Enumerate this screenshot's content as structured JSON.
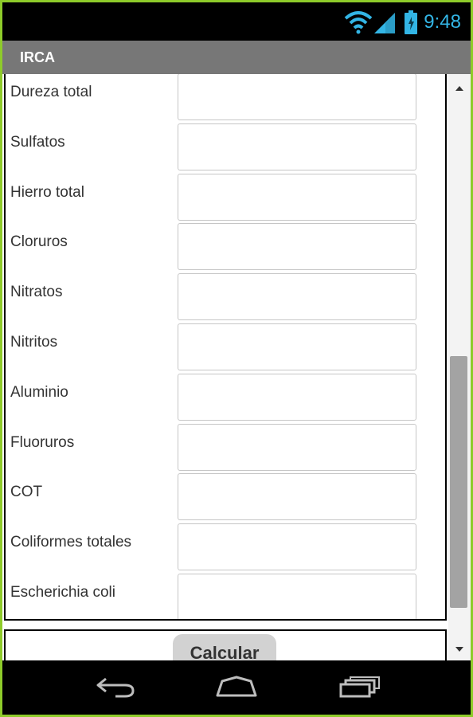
{
  "status_bar": {
    "time": "9:48",
    "icons": [
      "wifi-icon",
      "signal-icon",
      "battery-icon"
    ],
    "accent_color": "#33b5e5"
  },
  "app": {
    "title": "IRCA"
  },
  "form": {
    "fields": [
      {
        "label": "Dureza total",
        "value": ""
      },
      {
        "label": "Sulfatos",
        "value": ""
      },
      {
        "label": "Hierro total",
        "value": ""
      },
      {
        "label": "Cloruros",
        "value": ""
      },
      {
        "label": "Nitratos",
        "value": ""
      },
      {
        "label": "Nitritos",
        "value": ""
      },
      {
        "label": "Aluminio",
        "value": ""
      },
      {
        "label": "Fluoruros",
        "value": ""
      },
      {
        "label": "COT",
        "value": ""
      },
      {
        "label": "Coliformes totales",
        "value": ""
      },
      {
        "label": "Escherichia coli",
        "value": ""
      }
    ]
  },
  "actions": {
    "calculate_label": "Calcular"
  },
  "navigation": {
    "buttons": [
      "back-icon",
      "home-icon",
      "recent-apps-icon"
    ]
  },
  "colors": {
    "frame_border": "#8ecb2a",
    "title_bar": "#777777",
    "scroll_thumb": "#a3a3a3"
  }
}
